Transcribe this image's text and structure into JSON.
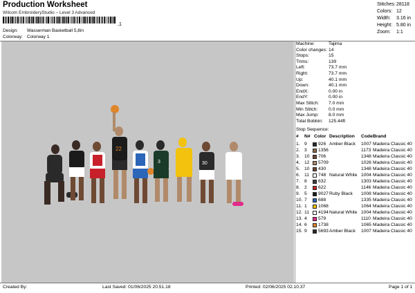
{
  "header": {
    "title": "Production Worksheet",
    "subtitle": "Wilcom EmbroideryStudio – Level 3 Advanced",
    "barcode_suffix": ",1",
    "design_label": "Design:",
    "design_value": "Wasserman Basketball 5,8in",
    "colorway_label": "Colorway:",
    "colorway_value": "Colorway 1"
  },
  "stats": [
    {
      "label": "Stitches:",
      "value": "28118"
    },
    {
      "label": "Colors:",
      "value": "12"
    },
    {
      "label": "Width:",
      "value": "3.16 in"
    },
    {
      "label": "Height:",
      "value": "5.80 in"
    },
    {
      "label": "Zoom:",
      "value": "1:1"
    }
  ],
  "machine_info": [
    {
      "label": "Machine:",
      "value": "Tajima"
    },
    {
      "label": "Color changes:",
      "value": "14"
    },
    {
      "label": "Stops:",
      "value": "15"
    },
    {
      "label": "Trims:",
      "value": "139"
    },
    {
      "label": "Left:",
      "value": "73.7 mm"
    },
    {
      "label": "Right:",
      "value": "73.7 mm"
    },
    {
      "label": "Up:",
      "value": "40.1 mm"
    },
    {
      "label": "Down:",
      "value": "40.1 mm"
    },
    {
      "label": "EndX:",
      "value": "0.00 in"
    },
    {
      "label": "EndY:",
      "value": "0.00 in"
    },
    {
      "label": "Max Stitch:",
      "value": "7.0 mm"
    },
    {
      "label": "Min Stitch:",
      "value": "0.0 mm"
    },
    {
      "label": "Max Jump:",
      "value": "8.0 mm"
    },
    {
      "label": "Total Bobbin:",
      "value": "125.44ft"
    }
  ],
  "stop_sequence": {
    "title": "Stop Sequence:",
    "headers": {
      "num": "#",
      "n": "N#",
      "color": "Color",
      "desc": "Description",
      "code": "Code",
      "brand": "Brand"
    },
    "rows": [
      {
        "num": "1.",
        "n": "9",
        "swatch": "#2a2a2a",
        "color": "926",
        "desc": "Amber Black",
        "code": "1007",
        "brand": "Madeira Classic 40"
      },
      {
        "num": "2.",
        "n": "3",
        "swatch": "#8a6a4e",
        "color": "1356",
        "desc": "",
        "code": "1173",
        "brand": "Madeira Classic 40"
      },
      {
        "num": "3.",
        "n": "10",
        "swatch": "#6e4a34",
        "color": "706",
        "desc": "",
        "code": "1348",
        "brand": "Madeira Classic 40"
      },
      {
        "num": "4.",
        "n": "12",
        "swatch": "#b08a6a",
        "color": "5709",
        "desc": "",
        "code": "1026",
        "brand": "Madeira Classic 40"
      },
      {
        "num": "5.",
        "n": "10",
        "swatch": "#6e4a34",
        "color": "430",
        "desc": "",
        "code": "1348",
        "brand": "Madeira Classic 40"
      },
      {
        "num": "6.",
        "n": "11",
        "swatch": "#ffffff",
        "color": "748",
        "desc": "Natural White",
        "code": "1004",
        "brand": "Madeira Classic 40"
      },
      {
        "num": "7.",
        "n": "8",
        "swatch": "#3b3f44",
        "color": "632",
        "desc": "",
        "code": "1303",
        "brand": "Madeira Classic 40"
      },
      {
        "num": "8.",
        "n": "2",
        "swatch": "#c8202a",
        "color": "622",
        "desc": "",
        "code": "1146",
        "brand": "Madeira Classic 40"
      },
      {
        "num": "9.",
        "n": "5",
        "swatch": "#1b1b1b",
        "color": "9027",
        "desc": "Ruby Black",
        "code": "1008",
        "brand": "Madeira Classic 40"
      },
      {
        "num": "10.",
        "n": "7",
        "swatch": "#2b66b8",
        "color": "688",
        "desc": "",
        "code": "1335",
        "brand": "Madeira Classic 40"
      },
      {
        "num": "11.",
        "n": "1",
        "swatch": "#f2c20e",
        "color": "1068",
        "desc": "",
        "code": "1064",
        "brand": "Madeira Classic 40"
      },
      {
        "num": "12.",
        "n": "11",
        "swatch": "#ffffff",
        "color": "4194",
        "desc": "Natural White",
        "code": "1004",
        "brand": "Madeira Classic 40"
      },
      {
        "num": "13.",
        "n": "4",
        "swatch": "#e02a8a",
        "color": "579",
        "desc": "",
        "code": "1110",
        "brand": "Madeira Classic 40"
      },
      {
        "num": "14.",
        "n": "6",
        "swatch": "#e0862a",
        "color": "1738",
        "desc": "",
        "code": "1065",
        "brand": "Madeira Classic 40"
      },
      {
        "num": "15.",
        "n": "9",
        "swatch": "#2a2a2a",
        "color": "5693",
        "desc": "Amber Black",
        "code": "1007",
        "brand": "Madeira Classic 40"
      }
    ]
  },
  "footer": {
    "created_by": "Created By:",
    "last_saved": "Last Saved: 01/06/2025 20.51.18",
    "printed": "Printed: 02/06/2025 02.10.37",
    "page": "Page 1 of 1"
  }
}
